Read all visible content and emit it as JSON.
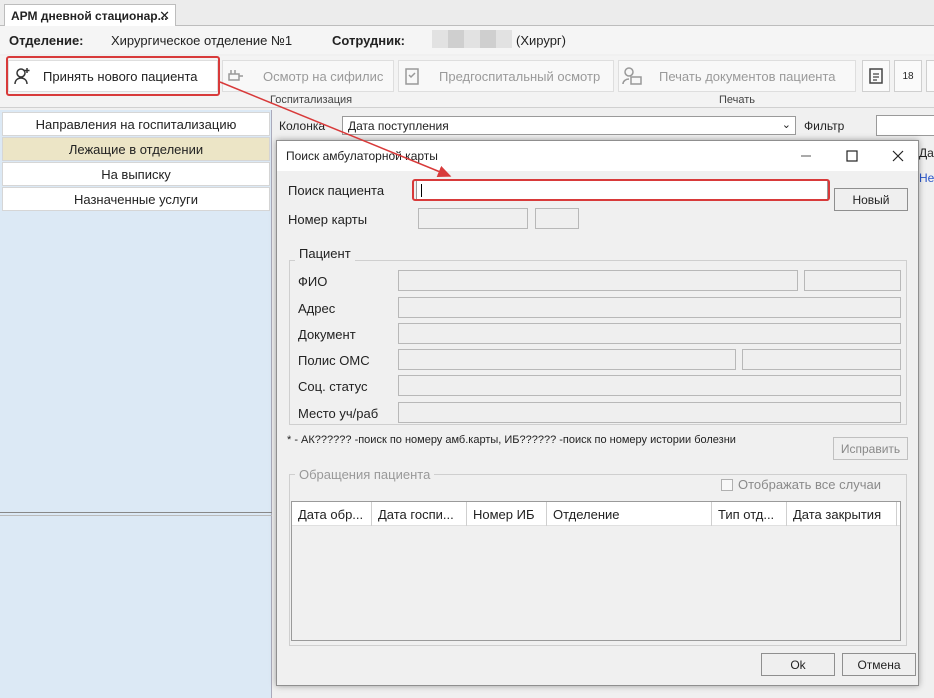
{
  "tab": {
    "title": "АРМ дневной стационар...",
    "close": "✕"
  },
  "info": {
    "department_label": "Отделение:",
    "department_value": "Хирургическое отделение №1",
    "employee_label": "Сотрудник:",
    "employee_role": "(Хирург)"
  },
  "toolbar": {
    "admit": "Принять нового пациента",
    "syphilis": "Осмотр на сифилис",
    "prehosp": "Предгоспитальный осмотр",
    "print_docs": "Печать документов пациента",
    "group_hosp": "Госпитализация",
    "group_print": "Печать",
    "calendar_num": "18"
  },
  "sidebar": {
    "items": [
      "Направления на госпитализацию",
      "Лежащие в отделении",
      "На выписку",
      "Назначенные услуги"
    ]
  },
  "filter": {
    "column_label": "Колонка",
    "column_value": "Дата поступления",
    "filter_label": "Фильтр",
    "peek_top": "Да",
    "peek_link": "Не"
  },
  "dialog": {
    "title": "Поиск амбулаторной карты",
    "search_label": "Поиск пациента",
    "card_label": "Номер карты",
    "new_btn": "Новый",
    "patient_group": "Пациент",
    "fio": "ФИО",
    "address": "Адрес",
    "document": "Документ",
    "oms": "Полис ОМС",
    "social": "Соц. статус",
    "workplace": "Место уч/раб",
    "note": "* - АК?????? -поиск по номеру амб.карты, ИБ?????? -поиск по номеру истории болезни",
    "fix_btn": "Исправить",
    "requests_group": "Обращения пациента",
    "show_all": "Отображать все случаи",
    "columns": [
      "Дата обр...",
      "Дата госпи...",
      "Номер ИБ",
      "Отделение",
      "Тип отд...",
      "Дата закрытия"
    ],
    "ok": "Ok",
    "cancel": "Отмена"
  },
  "colors": {
    "highlight": "#d83a3a",
    "selected": "#ece5c6",
    "sidebar_bg": "#dce9f5"
  }
}
